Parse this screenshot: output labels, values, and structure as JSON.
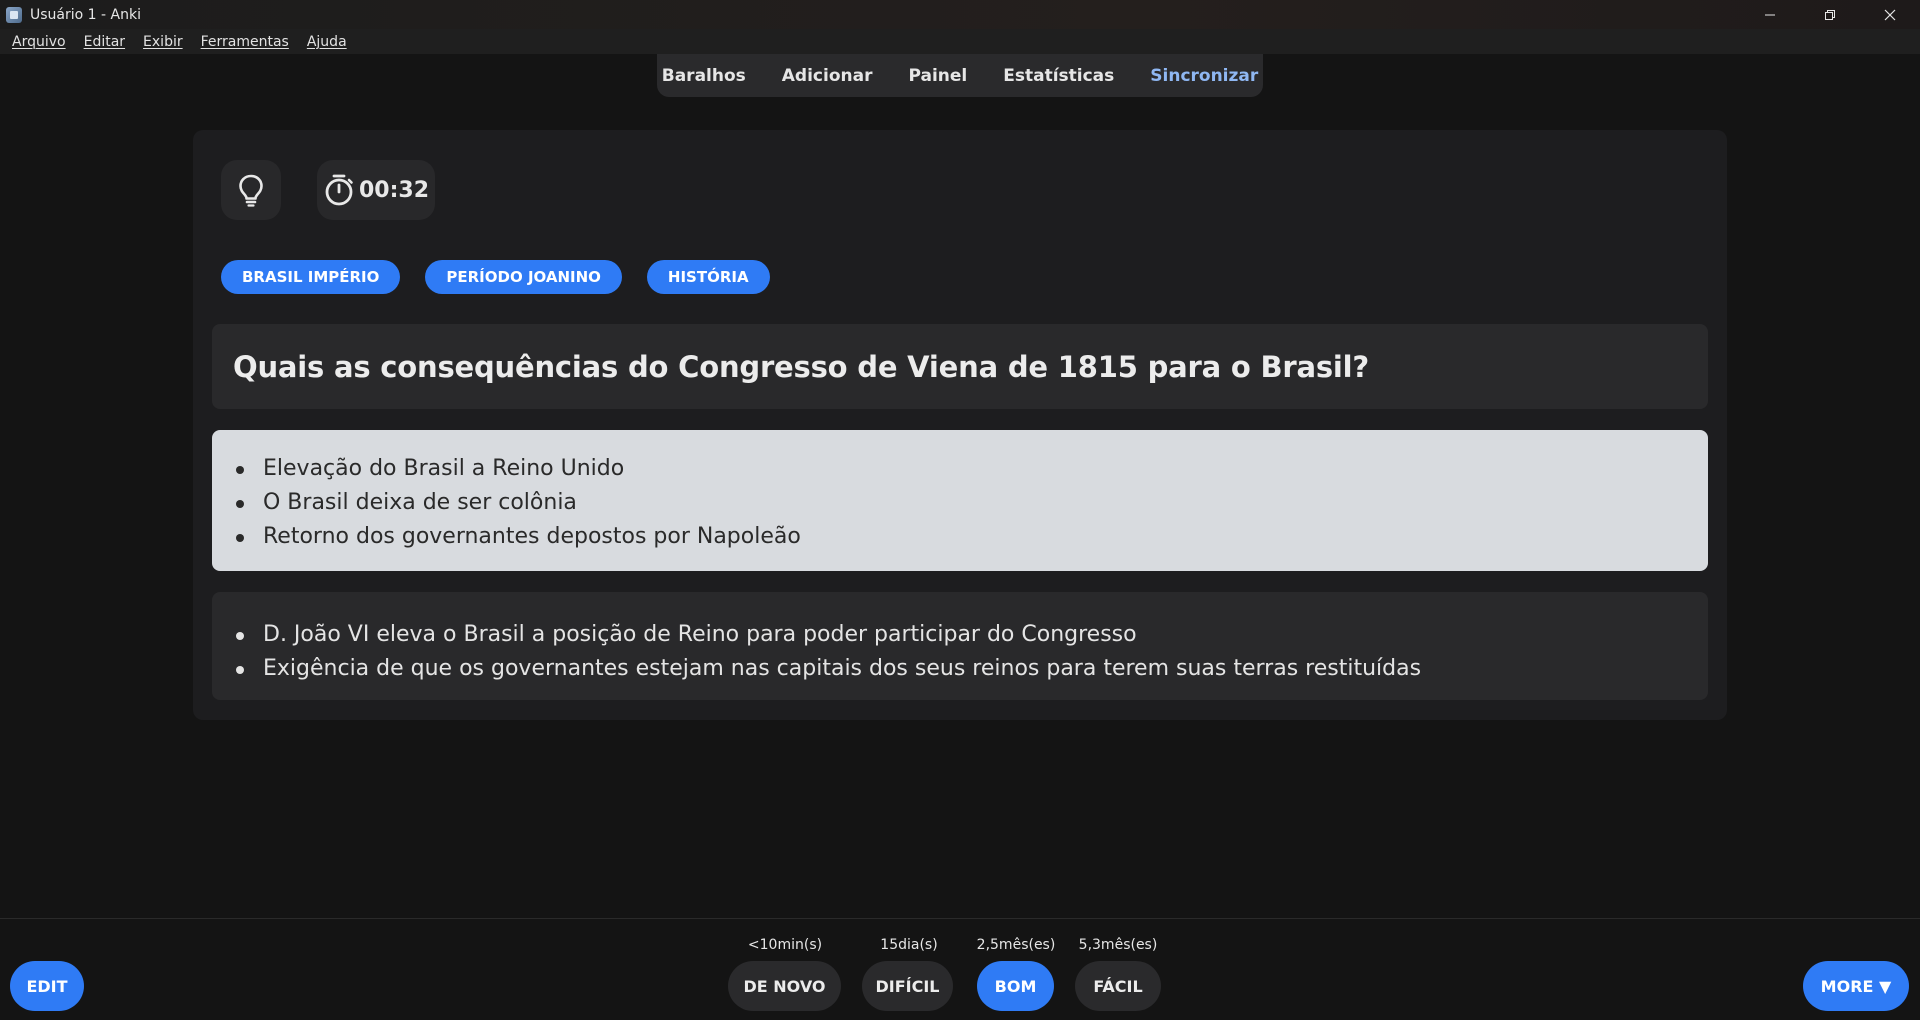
{
  "window": {
    "title": "Usuário 1 - Anki",
    "controls": [
      "minimize-icon",
      "restore-icon",
      "close-icon"
    ]
  },
  "menubar": {
    "items": [
      "Arquivo",
      "Editar",
      "Exibir",
      "Ferramentas",
      "Ajuda"
    ]
  },
  "nav": {
    "items": [
      "Baralhos",
      "Adicionar",
      "Painel",
      "Estatísticas",
      "Sincronizar"
    ],
    "sync_color": "#8fb7f2"
  },
  "card": {
    "hint_icon": "lightbulb-icon",
    "timer_icon": "stopwatch-icon",
    "timer": "00:32",
    "tags": [
      "BRASIL IMPÉRIO",
      "PERÍODO JOANINO",
      "HISTÓRIA"
    ],
    "question": "Quais as consequências do Congresso de Viena de 1815 para o Brasil?",
    "answer": [
      "Elevação do Brasil a Reino Unido",
      "O Brasil deixa de ser colônia",
      "Retorno dos governantes depostos por Napoleão"
    ],
    "extra": [
      "D. João VI eleva o Brasil a posição de Reino para poder participar do Congresso",
      "Exigência de que os governantes estejam nas capitais dos seus reinos para terem suas terras restituídas"
    ]
  },
  "bottom": {
    "edit_label": "EDIT",
    "more_label": "MORE ▼",
    "intervals": [
      "<10min(s)",
      "15dia(s)",
      "2,5mês(es)",
      "5,3mês(es)"
    ],
    "buttons": [
      "DE NOVO",
      "DIFÍCIL",
      "BOM",
      "FÁCIL"
    ]
  },
  "colors": {
    "accent": "#2f7bf5",
    "background": "#141414",
    "answer_background": "#d8dbdf"
  }
}
